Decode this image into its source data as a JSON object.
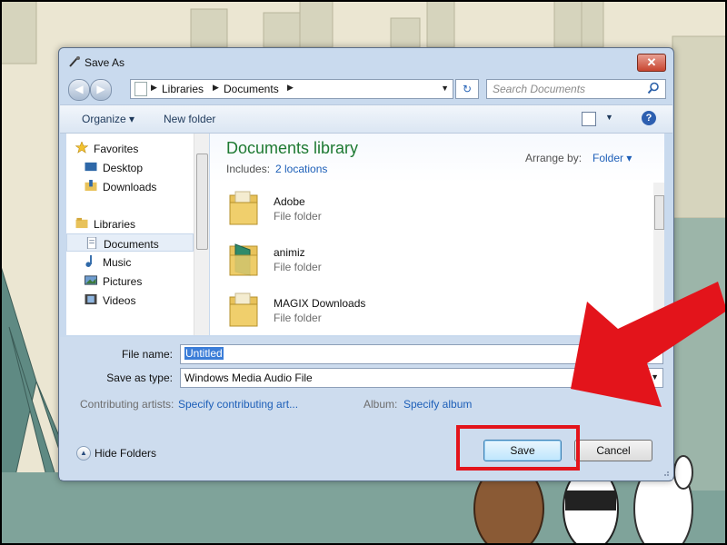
{
  "window": {
    "title": "Save As",
    "close_symbol": "✕",
    "back_symbol": "◀",
    "forward_symbol": "▶"
  },
  "address": {
    "breadcrumbs": [
      "Libraries",
      "Documents"
    ],
    "separator": "▶",
    "dropdown_symbol": "▼",
    "refresh_symbol": "↻"
  },
  "search": {
    "placeholder": "Search Documents",
    "icon": "search-icon"
  },
  "toolbar": {
    "organize_label": "Organize ▾",
    "new_folder_label": "New folder",
    "views_dropdown": "▼",
    "help_label": "?"
  },
  "sidebar": {
    "favorites": {
      "label": "Favorites",
      "items": [
        "Desktop",
        "Downloads"
      ]
    },
    "libraries": {
      "label": "Libraries",
      "items": [
        "Documents",
        "Music",
        "Pictures",
        "Videos"
      ]
    },
    "selected": "Documents"
  },
  "library": {
    "title": "Documents library",
    "includes_label": "Includes:",
    "locations_link": "2 locations",
    "arrange_label": "Arrange by:",
    "arrange_value": "Folder ▾"
  },
  "files": [
    {
      "name": "Adobe",
      "type": "File folder"
    },
    {
      "name": "animiz",
      "type": "File folder"
    },
    {
      "name": "MAGIX Downloads",
      "type": "File folder"
    }
  ],
  "form": {
    "file_name_label": "File name:",
    "file_name_value": "Untitled",
    "save_as_type_label": "Save as type:",
    "save_as_type_value": "Windows Media Audio File",
    "contributing_label": "Contributing artists:",
    "contributing_value": "Specify contributing art...",
    "album_label": "Album:",
    "album_value": "Specify album"
  },
  "footer": {
    "hide_folders_label": "Hide Folders",
    "hide_folders_symbol": "▲",
    "save_label": "Save",
    "cancel_label": "Cancel"
  },
  "colors": {
    "annotation_red": "#e3141b",
    "library_title_green": "#1e7a32",
    "link_blue": "#1d5fb8"
  }
}
